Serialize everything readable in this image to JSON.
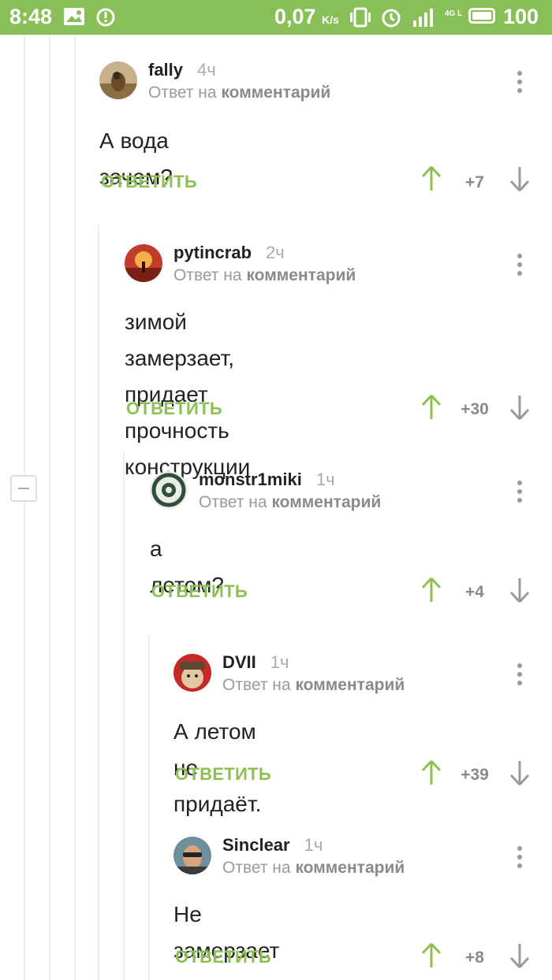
{
  "status_bar": {
    "time": "8:48",
    "speed": "0,07",
    "speed_unit": "K/s",
    "network": "4G LTE",
    "battery": "100"
  },
  "accent_color": "#8cc152",
  "icons": [
    "gallery-notification-icon",
    "sync-icon",
    "vibrate-icon",
    "alarm-icon",
    "signal-icon",
    "battery-icon",
    "vote-up-icon",
    "vote-down-icon",
    "more-menu-icon",
    "collapse-thread-icon"
  ],
  "comments": [
    {
      "author": "fally",
      "time": "4ч",
      "reply_prefix": "Ответ на",
      "reply_target": "комментарий",
      "text_lines": [
        "А вода зачем?"
      ],
      "reply_label": "ОТВЕТИТЬ",
      "score": "+7"
    },
    {
      "author": "pytincrab",
      "time": "2ч",
      "reply_prefix": "Ответ на",
      "reply_target": "комментарий",
      "text_lines": [
        "зимой замерзает, придает",
        "прочность конструкции"
      ],
      "reply_label": "ОТВЕТИТЬ",
      "score": "+30"
    },
    {
      "author": "monstr1miki",
      "time": "1ч",
      "reply_prefix": "Ответ на",
      "reply_target": "комментарий",
      "text_lines": [
        "а летом?"
      ],
      "reply_label": "ОТВЕТИТЬ",
      "score": "+4"
    },
    {
      "author": "DVII",
      "time": "1ч",
      "reply_prefix": "Ответ на",
      "reply_target": "комментарий",
      "text_lines": [
        "А летом не придаёт."
      ],
      "reply_label": "ОТВЕТИТЬ",
      "score": "+39"
    },
    {
      "author": "Sinclear",
      "time": "1ч",
      "reply_prefix": "Ответ на",
      "reply_target": "комментарий",
      "text_lines": [
        "Не замерзает"
      ],
      "reply_label": "ОТВЕТИТЬ",
      "score": "+8"
    }
  ]
}
